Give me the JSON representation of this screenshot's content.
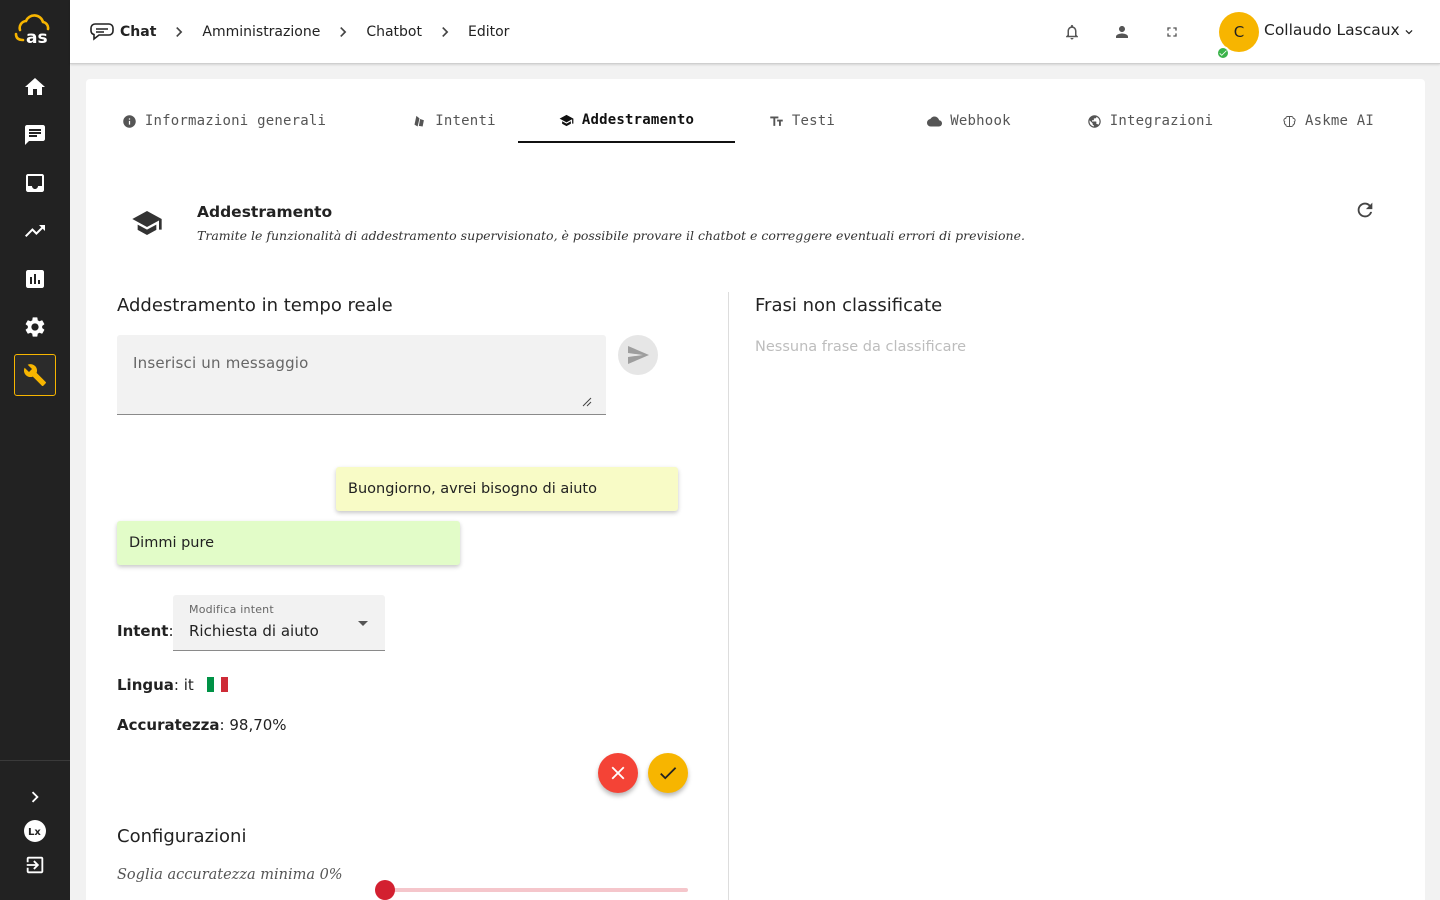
{
  "breadcrumb": {
    "items": [
      "Chat",
      "Amministrazione",
      "Chatbot",
      "Editor"
    ]
  },
  "user": {
    "initial": "C",
    "name": "Collaudo Lascaux",
    "status": "online"
  },
  "sidebar": {
    "items": [
      {
        "icon": "home-icon"
      },
      {
        "icon": "chat-icon"
      },
      {
        "icon": "inbox-icon"
      },
      {
        "icon": "trending-icon"
      },
      {
        "icon": "bar-chart-icon"
      },
      {
        "icon": "gear-icon"
      },
      {
        "icon": "wrench-icon",
        "active": true
      }
    ],
    "bottom": [
      {
        "icon": "chevron-right-icon"
      },
      {
        "icon": "lx-logo-icon"
      },
      {
        "icon": "logout-icon"
      }
    ]
  },
  "tabs": [
    {
      "label": "Informazioni generali",
      "icon": "info-icon"
    },
    {
      "label": "Intenti",
      "icon": "shapes-icon"
    },
    {
      "label": "Addestramento",
      "icon": "graduation-cap-icon",
      "active": true
    },
    {
      "label": "Testi",
      "icon": "text-size-icon"
    },
    {
      "label": "Webhook",
      "icon": "cloud-icon"
    },
    {
      "label": "Integrazioni",
      "icon": "globe-icon"
    },
    {
      "label": "Askme AI",
      "icon": "brain-icon"
    }
  ],
  "section": {
    "title": "Addestramento",
    "subtitle": "Tramite le funzionalità di addestramento supervisionato, è possibile provare il chatbot e correggere eventuali errori di previsione."
  },
  "training": {
    "title": "Addestramento in tempo reale",
    "input_placeholder": "Inserisci un messaggio",
    "user_message": "Buongiorno, avrei bisogno di aiuto",
    "bot_message": "Dimmi pure",
    "intent_label": "Intent",
    "intent_field_label": "Modifica intent",
    "intent_value": "Richiesta di aiuto",
    "language_label": "Lingua",
    "language_value": "it",
    "accuracy_label": "Accuratezza",
    "accuracy_value": "98,70%"
  },
  "unclassified": {
    "title": "Frasi non classificate",
    "empty": "Nessuna frase da classificare"
  },
  "config": {
    "title": "Configurazioni",
    "threshold_label": "Soglia accuratezza minima 0%",
    "threshold_value": 0
  },
  "colors": {
    "accent": "#f7b500",
    "sidebar": "#222222",
    "reject": "#f44336",
    "slider": "#d32030",
    "user_bubble": "#f8fbc6",
    "bot_bubble": "#e2fcc8"
  }
}
